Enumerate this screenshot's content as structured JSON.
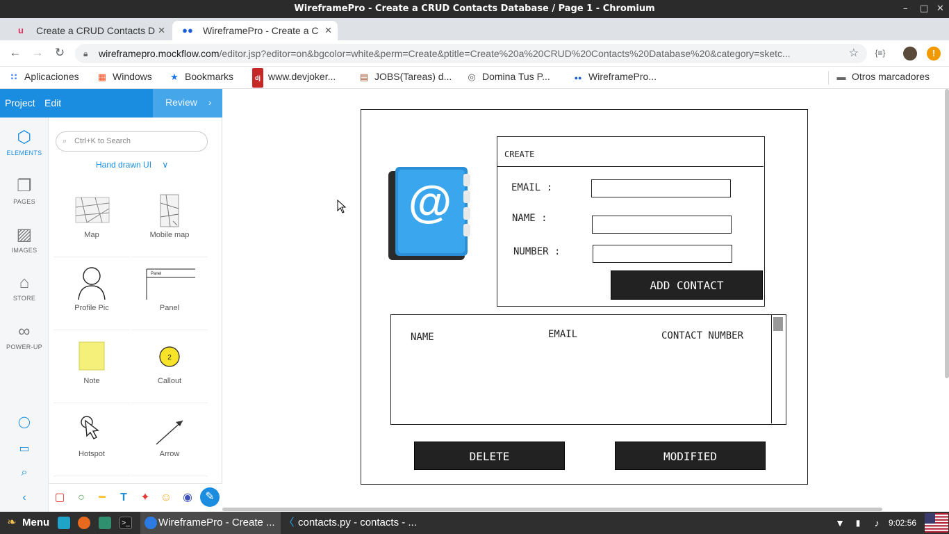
{
  "window": {
    "title": "WireframePro - Create a CRUD Contacts Database / Page 1 - Chromium"
  },
  "tabs": [
    {
      "label": "Create a CRUD Contacts D",
      "icon": "udemy-icon"
    },
    {
      "label": "WireframePro - Create a C",
      "icon": "wireframepro-icon"
    }
  ],
  "address": {
    "host": "wireframepro.mockflow.com",
    "path": "/editor.jsp?editor=on&bgcolor=white&perm=Create&ptitle=Create%20a%20CRUD%20Contacts%20Database%20&category=sketc..."
  },
  "bookmarks": [
    {
      "label": "Aplicaciones",
      "icon": "apps-grid-icon"
    },
    {
      "label": "Windows",
      "icon": "windows-icon"
    },
    {
      "label": "Bookmarks",
      "icon": "star-icon"
    },
    {
      "label": "www.devjoker...",
      "icon": "devjoker-icon"
    },
    {
      "label": "JOBS(Tareas) d...",
      "icon": "jobs-icon"
    },
    {
      "label": "Domina Tus P...",
      "icon": "globe-icon"
    },
    {
      "label": "WireframePro...",
      "icon": "wireframepro-icon"
    }
  ],
  "other_bookmarks": "Otros marcadores",
  "editor": {
    "menu": {
      "project": "Project",
      "edit": "Edit",
      "review": "Review"
    },
    "rail": [
      {
        "label": "ELEMENTS",
        "icon": "cube-icon"
      },
      {
        "label": "PAGES",
        "icon": "pages-icon"
      },
      {
        "label": "IMAGES",
        "icon": "image-icon"
      },
      {
        "label": "STORE",
        "icon": "store-icon"
      },
      {
        "label": "POWER-UP",
        "icon": "infinity-icon"
      }
    ],
    "search_placeholder": "Ctrl+K to Search",
    "library": "Hand drawn UI",
    "elements": [
      {
        "label": "Map"
      },
      {
        "label": "Mobile map"
      },
      {
        "label": "Profile Pic"
      },
      {
        "label": "Panel",
        "thumb_text": "Panel"
      },
      {
        "label": "Note"
      },
      {
        "label": "Callout",
        "thumb_text": "2"
      },
      {
        "label": "Hotspot"
      },
      {
        "label": "Arrow"
      }
    ]
  },
  "wireframe": {
    "panel_title": "CREATE",
    "fields": [
      {
        "label": "EMAIL :"
      },
      {
        "label": "NAME :"
      },
      {
        "label": "NUMBER :"
      }
    ],
    "add_button": "ADD CONTACT",
    "list_columns": [
      "NAME",
      "EMAIL",
      "CONTACT NUMBER"
    ],
    "delete_button": "DELETE",
    "modify_button": "MODIFIED",
    "icon_glyph": "@"
  },
  "taskbar": {
    "menu": "Menu",
    "windows": [
      {
        "label": "WireframePro - Create ...",
        "icon": "chromium-icon"
      },
      {
        "label": "contacts.py - contacts - ...",
        "icon": "vscode-icon"
      }
    ],
    "clock": "9:02:56"
  },
  "colors": {
    "accent": "#1a8de0",
    "titlebar": "#2b2b2b",
    "button_dark": "#222222",
    "taskbar": "#2f2f2f"
  }
}
